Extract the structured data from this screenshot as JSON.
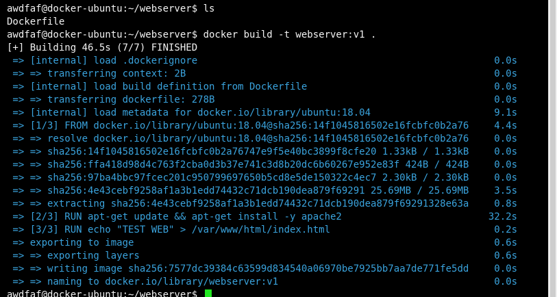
{
  "terminal": {
    "lines": [
      {
        "text": "awdfaf@docker-ubuntu:~/webserver$ ls",
        "time": "",
        "color": "white"
      },
      {
        "text": "Dockerfile",
        "time": "",
        "color": "white"
      },
      {
        "text": "awdfaf@docker-ubuntu:~/webserver$ docker build -t webserver:v1 .",
        "time": "",
        "color": "white"
      },
      {
        "text": "[+] Building 46.5s (7/7) FINISHED",
        "time": "",
        "color": "white"
      },
      {
        "text": " => [internal] load .dockerignore",
        "time": "0.0s",
        "color": "blue"
      },
      {
        "text": " => => transferring context: 2B",
        "time": "0.0s",
        "color": "blue"
      },
      {
        "text": " => [internal] load build definition from Dockerfile",
        "time": "0.0s",
        "color": "blue"
      },
      {
        "text": " => => transferring dockerfile: 278B",
        "time": "0.0s",
        "color": "blue"
      },
      {
        "text": " => [internal] load metadata for docker.io/library/ubuntu:18.04",
        "time": "9.1s",
        "color": "blue"
      },
      {
        "text": " => [1/3] FROM docker.io/library/ubuntu:18.04@sha256:14f1045816502e16fcbfc0b2a76",
        "time": "4.4s",
        "color": "blue"
      },
      {
        "text": " => => resolve docker.io/library/ubuntu:18.04@sha256:14f1045816502e16fcbfc0b2a76",
        "time": "0.0s",
        "color": "blue"
      },
      {
        "text": " => => sha256:14f1045816502e16fcbfc0b2a76747e9f5e40bc3899f8cfe20 1.33kB / 1.33kB",
        "time": "0.0s",
        "color": "blue"
      },
      {
        "text": " => => sha256:ffa418d98d4c763f2cba0d3b37e741c3d8b20dc6b60267e952e83f 424B / 424B",
        "time": "0.0s",
        "color": "blue"
      },
      {
        "text": " => => sha256:97ba4bbc97fcec201c950799697650b5cd8e5de150322c4ec7 2.30kB / 2.30kB",
        "time": "0.0s",
        "color": "blue"
      },
      {
        "text": " => => sha256:4e43cebf9258af1a3b1edd74432c71dcb190dea879f69291 25.69MB / 25.69MB",
        "time": "3.5s",
        "color": "blue"
      },
      {
        "text": " => => extracting sha256:4e43cebf9258af1a3b1edd74432c71dcb190dea879f69291328e63a",
        "time": "0.8s",
        "color": "blue"
      },
      {
        "text": " => [2/3] RUN apt-get update && apt-get install -y apache2",
        "time": "32.2s",
        "color": "blue"
      },
      {
        "text": " => [3/3] RUN echo \"TEST WEB\" > /var/www/html/index.html",
        "time": "0.2s",
        "color": "blue"
      },
      {
        "text": " => exporting to image",
        "time": "0.6s",
        "color": "blue"
      },
      {
        "text": " => => exporting layers",
        "time": "0.6s",
        "color": "blue"
      },
      {
        "text": " => => writing image sha256:7577dc39384c63599d834540a06970be7925bb7aa7de771fe5dd",
        "time": "0.0s",
        "color": "blue"
      },
      {
        "text": " => => naming to docker.io/library/webserver:v1",
        "time": "0.0s",
        "color": "blue"
      }
    ],
    "prompt": "awdfaf@docker-ubuntu:~/webserver$ ",
    "colors": {
      "background": "#000000",
      "text": "#f2f2f2",
      "build_output": "#3aa3dd",
      "cursor": "#22e822"
    }
  }
}
